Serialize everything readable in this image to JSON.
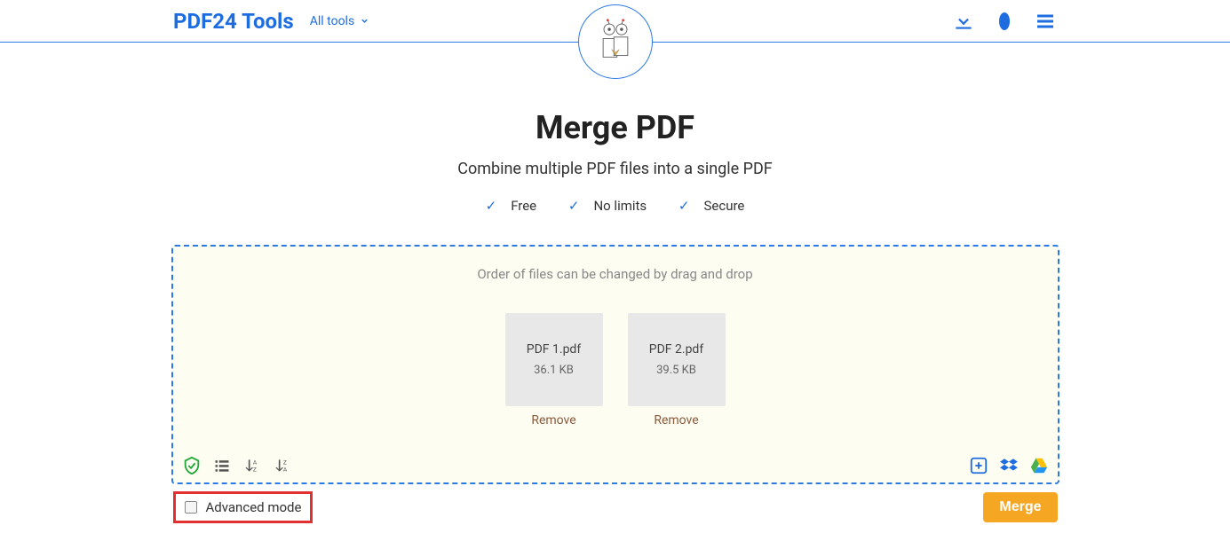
{
  "header": {
    "brand": "PDF24 Tools",
    "all_tools": "All tools"
  },
  "page": {
    "title": "Merge PDF",
    "subtitle": "Combine multiple PDF files into a single PDF"
  },
  "features": {
    "free": "Free",
    "no_limits": "No limits",
    "secure": "Secure"
  },
  "drop": {
    "hint": "Order of files can be changed by drag and drop"
  },
  "files": [
    {
      "name": "PDF 1.pdf",
      "size": "36.1 KB",
      "remove": "Remove"
    },
    {
      "name": "PDF 2.pdf",
      "size": "39.5 KB",
      "remove": "Remove"
    }
  ],
  "bottom": {
    "advanced_label": "Advanced mode",
    "merge_label": "Merge"
  }
}
